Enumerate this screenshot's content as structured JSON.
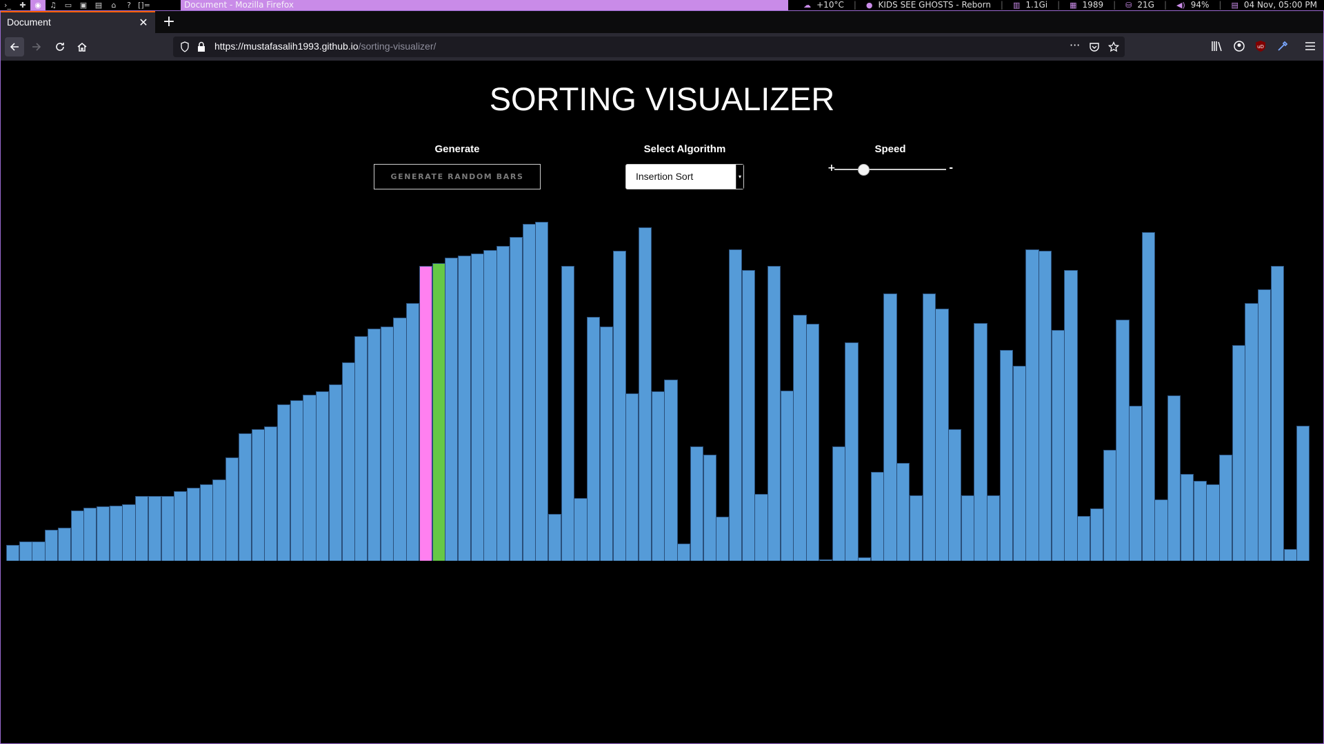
{
  "system_bar": {
    "workspaces": [
      "›_",
      "✚",
      "◉",
      "♫",
      "▭",
      "▣",
      "▤",
      "⌂",
      "?",
      "[]="
    ],
    "active_workspace": 2,
    "window_title": "Document - Mozilla Firefox",
    "weather": "+10°C",
    "music": "KIDS SEE GHOSTS - Reborn",
    "memory": "1.1Gi",
    "packages": "1989",
    "disk": "21G",
    "volume": "94%",
    "datetime": "04 Nov, 05:00 PM",
    "accent_color": "#c98be8"
  },
  "browser": {
    "tab_title": "Document",
    "url_host": "https://mustafasalih1993.github.io",
    "url_path": "/sorting-visualizer/"
  },
  "page": {
    "title": "SORTING VISUALIZER",
    "generate_label": "Generate",
    "generate_button": "GENERATE RANDOM BARS",
    "algorithm_label": "Select Algorithm",
    "algorithm_selected": "Insertion Sort",
    "speed_label": "Speed",
    "speed_plus": "+",
    "speed_minus": "-",
    "speed_value": 0.26
  },
  "bars": {
    "colors": {
      "default": "#559bd8",
      "comparing": "#ff80f0",
      "current": "#66c845"
    },
    "current_index": 33,
    "comparing_index": 32,
    "values": [
      24,
      29,
      29,
      46,
      50,
      75,
      80,
      82,
      83,
      85,
      97,
      97,
      97,
      104,
      109,
      115,
      122,
      155,
      191,
      197,
      201,
      234,
      241,
      249,
      254,
      264,
      297,
      337,
      348,
      351,
      364,
      386,
      442,
      446,
      454,
      457,
      461,
      466,
      472,
      485,
      505,
      508,
      70,
      442,
      94,
      366,
      351,
      465,
      251,
      500,
      254,
      272,
      26,
      171,
      159,
      66,
      467,
      436,
      100,
      442,
      255,
      369,
      355,
      0,
      171,
      327,
      5,
      133,
      401,
      147,
      98,
      401,
      378,
      197,
      98,
      356,
      98,
      316,
      292,
      467,
      465,
      346,
      436,
      67,
      78,
      166,
      361,
      232,
      493,
      92,
      248,
      130,
      120,
      115,
      159,
      323,
      386,
      407,
      442,
      18,
      202
    ],
    "y_max": 510
  }
}
